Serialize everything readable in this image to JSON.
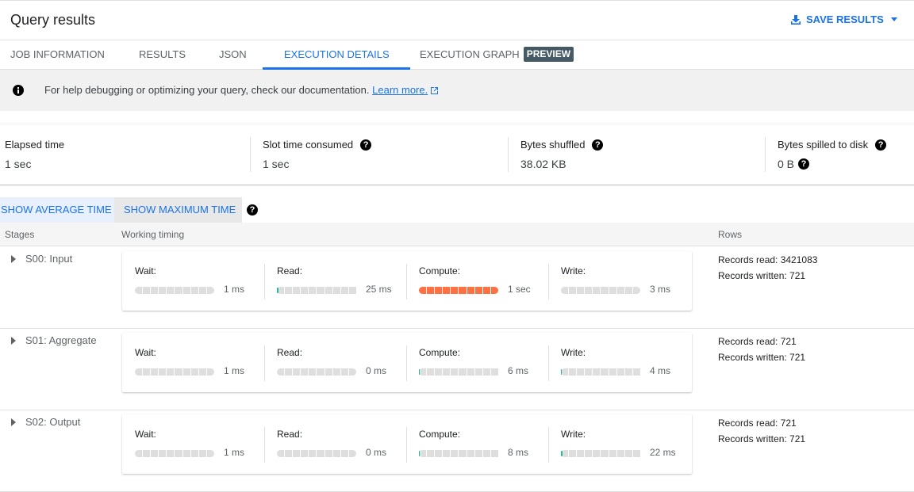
{
  "header": {
    "title": "Query results",
    "save_label": "SAVE RESULTS",
    "accent": "#1a73e8"
  },
  "tabs": [
    {
      "label": "JOB INFORMATION",
      "active": false
    },
    {
      "label": "RESULTS",
      "active": false
    },
    {
      "label": "JSON",
      "active": false
    },
    {
      "label": "EXECUTION DETAILS",
      "active": true
    },
    {
      "label": "EXECUTION GRAPH",
      "active": false,
      "badge": "PREVIEW"
    }
  ],
  "info": {
    "icon": "info-icon",
    "text": "For help debugging or optimizing your query, check our documentation.",
    "link": "Learn more."
  },
  "metrics": [
    {
      "label": "Elapsed time",
      "value": "1 sec",
      "help": false
    },
    {
      "label": "Slot time consumed",
      "value": "1 sec",
      "help": true
    },
    {
      "label": "Bytes shuffled",
      "value": "38.02 KB",
      "help": true
    },
    {
      "label": "Bytes spilled to disk",
      "value": "0 B",
      "help": true,
      "value_help": true
    }
  ],
  "toggles": {
    "average": "SHOW AVERAGE TIME",
    "maximum": "SHOW MAXIMUM TIME"
  },
  "table": {
    "headers": {
      "stages": "Stages",
      "timing": "Working timing",
      "rows": "Rows"
    },
    "stages": [
      {
        "name": "S00: Input",
        "timing": [
          {
            "label": "Wait:",
            "value": "1 ms",
            "fill": 0,
            "color": "none"
          },
          {
            "label": "Read:",
            "value": "25 ms",
            "fill": 0.02,
            "color": "#1abc9c"
          },
          {
            "label": "Compute:",
            "value": "1 sec",
            "fill": 1.0,
            "color": "#ff7043"
          },
          {
            "label": "Write:",
            "value": "3 ms",
            "fill": 0,
            "color": "none"
          }
        ],
        "records_read": "Records read: 3421083",
        "records_written": "Records written: 721"
      },
      {
        "name": "S01: Aggregate",
        "timing": [
          {
            "label": "Wait:",
            "value": "1 ms",
            "fill": 0,
            "color": "none"
          },
          {
            "label": "Read:",
            "value": "0 ms",
            "fill": 0,
            "color": "none"
          },
          {
            "label": "Compute:",
            "value": "6 ms",
            "fill": 0.005,
            "color": "#1abc9c"
          },
          {
            "label": "Write:",
            "value": "4 ms",
            "fill": 0.005,
            "color": "#1abc9c"
          }
        ],
        "records_read": "Records read: 721",
        "records_written": "Records written: 721"
      },
      {
        "name": "S02: Output",
        "timing": [
          {
            "label": "Wait:",
            "value": "1 ms",
            "fill": 0,
            "color": "none"
          },
          {
            "label": "Read:",
            "value": "0 ms",
            "fill": 0,
            "color": "none"
          },
          {
            "label": "Compute:",
            "value": "8 ms",
            "fill": 0.008,
            "color": "#1abc9c"
          },
          {
            "label": "Write:",
            "value": "22 ms",
            "fill": 0.02,
            "color": "#1abc9c"
          }
        ],
        "records_read": "Records read: 721",
        "records_written": "Records written: 721"
      }
    ]
  }
}
